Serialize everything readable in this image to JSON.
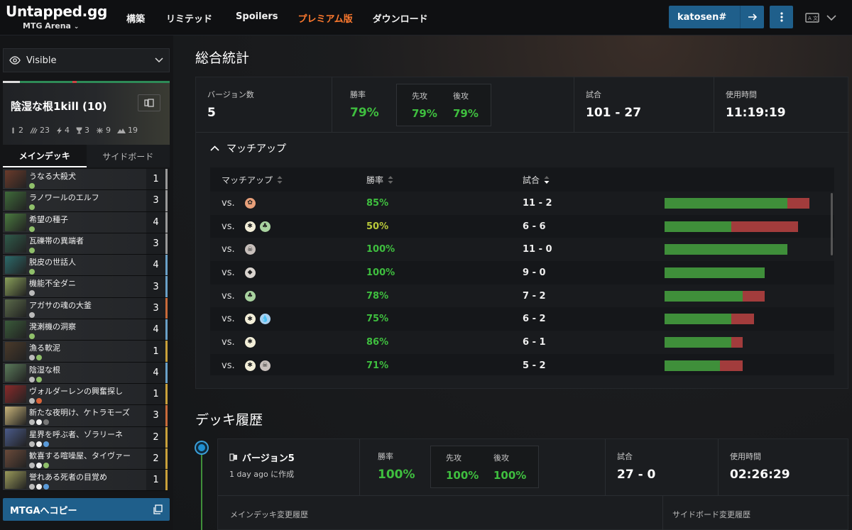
{
  "nav": {
    "logo_text": "Untapped.gg",
    "logo_sub": "MTG Arena",
    "links": [
      "構築",
      "リミテッド",
      "Spoilers",
      "プレミアム版",
      "ダウンロード"
    ],
    "username": "katosen#"
  },
  "sidebar": {
    "visibility_label": "Visible",
    "deck_title": "陰湿な根1kill (10)",
    "deck_stats": [
      "2",
      "23",
      "4",
      "3",
      "9",
      "19"
    ],
    "tabs": [
      "メインデッキ",
      "サイドボード"
    ],
    "cards": [
      {
        "name": "うなる大殺犬",
        "count": "1",
        "art": "#6b3b2b",
        "pips": [
          "#8fbf6a"
        ],
        "edge": "#999"
      },
      {
        "name": "ラノワールのエルフ",
        "count": "3",
        "art": "#3f6b3a",
        "pips": [
          "#8fbf6a"
        ],
        "edge": "#999"
      },
      {
        "name": "希望の種子",
        "count": "4",
        "art": "#4a7a3f",
        "pips": [
          "#8fbf6a"
        ],
        "edge": "#999"
      },
      {
        "name": "瓦礫帯の異端者",
        "count": "3",
        "art": "#2f5a4a",
        "pips": [
          "#8fbf6a"
        ],
        "edge": "#999"
      },
      {
        "name": "脱皮の世話人",
        "count": "4",
        "art": "#2c6a6a",
        "pips": [
          "#8fbf6a"
        ],
        "edge": "#6aa0c8"
      },
      {
        "name": "機能不全ダニ",
        "count": "3",
        "art": "#8aa05a",
        "pips": [
          "#bbb"
        ],
        "edge": "#6aa0c8"
      },
      {
        "name": "アガサの魂の大釜",
        "count": "3",
        "art": "#5a6a4a",
        "pips": [
          "#bbb"
        ],
        "edge": "#c86a3a"
      },
      {
        "name": "溌溂機の洞察",
        "count": "4",
        "art": "#3a5a3a",
        "pips": [
          "#8fbf6a"
        ],
        "edge": "#6aa0c8"
      },
      {
        "name": "漁る軟泥",
        "count": "1",
        "art": "#4a3a2a",
        "pips": [
          "#bbb",
          "#8fbf6a"
        ],
        "edge": "#c8a03a"
      },
      {
        "name": "陰湿な根",
        "count": "4",
        "art": "#5a7a5a",
        "pips": [
          "#bbb",
          "#8fbf6a"
        ],
        "edge": "#6aa0c8"
      },
      {
        "name": "ヴォルダーレンの興奮探し",
        "count": "1",
        "art": "#8a2a2a",
        "pips": [
          "#bbb",
          "#d9643a"
        ],
        "edge": "#c8a03a"
      },
      {
        "name": "新たな夜明け、ケトラモーズ",
        "count": "3",
        "art": "#c8b47a",
        "pips": [
          "#bbb",
          "#eee",
          "#777"
        ],
        "edge": "#c86a3a"
      },
      {
        "name": "星界を呼ぶ者、ゾラリーネ",
        "count": "2",
        "art": "#4a5a8a",
        "pips": [
          "#bbb",
          "#eee",
          "#5a9ad9"
        ],
        "edge": "#c8a03a"
      },
      {
        "name": "歓喜する喧噪屋、タイヴァー",
        "count": "2",
        "art": "#6a4a3a",
        "pips": [
          "#bbb",
          "#eee",
          "#8fbf6a"
        ],
        "edge": "#c8a03a"
      },
      {
        "name": "誉れある死者の目覚め",
        "count": "1",
        "art": "#9a9a5a",
        "pips": [
          "#bbb",
          "#eee",
          "#5a9ad9"
        ],
        "edge": "#c8a03a"
      }
    ],
    "copy_button": "MTGAへコピー"
  },
  "overall": {
    "title": "総合統計",
    "versions_label": "バージョン数",
    "versions_value": "5",
    "winrate_label": "勝率",
    "winrate_value": "79%",
    "play_label": "先攻",
    "play_value": "79%",
    "draw_label": "後攻",
    "draw_value": "79%",
    "matches_label": "試合",
    "matches_value": "101 - 27",
    "time_label": "使用時間",
    "time_value": "11:19:19"
  },
  "matchups": {
    "toggle_label": "マッチアップ",
    "col_matchup": "マッチアップ",
    "col_winrate": "勝率",
    "col_matches": "試合",
    "vs": "vs.",
    "rows": [
      {
        "symbols": [
          "R"
        ],
        "winrate": "85%",
        "record": "11 - 2",
        "wins": 11,
        "losses": 2
      },
      {
        "symbols": [
          "W",
          "G"
        ],
        "winrate": "50%",
        "record": "6 - 6",
        "wins": 6,
        "losses": 6
      },
      {
        "symbols": [
          "B"
        ],
        "winrate": "100%",
        "record": "11 - 0",
        "wins": 11,
        "losses": 0
      },
      {
        "symbols": [
          "C"
        ],
        "winrate": "100%",
        "record": "9 - 0",
        "wins": 9,
        "losses": 0
      },
      {
        "symbols": [
          "G"
        ],
        "winrate": "78%",
        "record": "7 - 2",
        "wins": 7,
        "losses": 2
      },
      {
        "symbols": [
          "W",
          "U"
        ],
        "winrate": "75%",
        "record": "6 - 2",
        "wins": 6,
        "losses": 2
      },
      {
        "symbols": [
          "W"
        ],
        "winrate": "86%",
        "record": "6 - 1",
        "wins": 6,
        "losses": 1
      },
      {
        "symbols": [
          "W",
          "B"
        ],
        "winrate": "71%",
        "record": "5 - 2",
        "wins": 5,
        "losses": 2
      }
    ]
  },
  "history": {
    "title": "デッキ履歴",
    "version_label": "バージョン5",
    "created": "1 day ago に作成",
    "winrate_label": "勝率",
    "winrate_value": "100%",
    "play_label": "先攻",
    "play_value": "100%",
    "draw_label": "後攻",
    "draw_value": "100%",
    "matches_label": "試合",
    "matches_value": "27 - 0",
    "time_label": "使用時間",
    "time_value": "02:26:29",
    "main_changes": "メインデッキ変更履歴",
    "side_changes": "サイドボード変更履歴"
  },
  "colors": {
    "accent_blue": "#1f5f8b",
    "win_green": "#3f8f3a",
    "loss_red": "#a23c3c",
    "premium_orange": "#ff7a2e"
  }
}
